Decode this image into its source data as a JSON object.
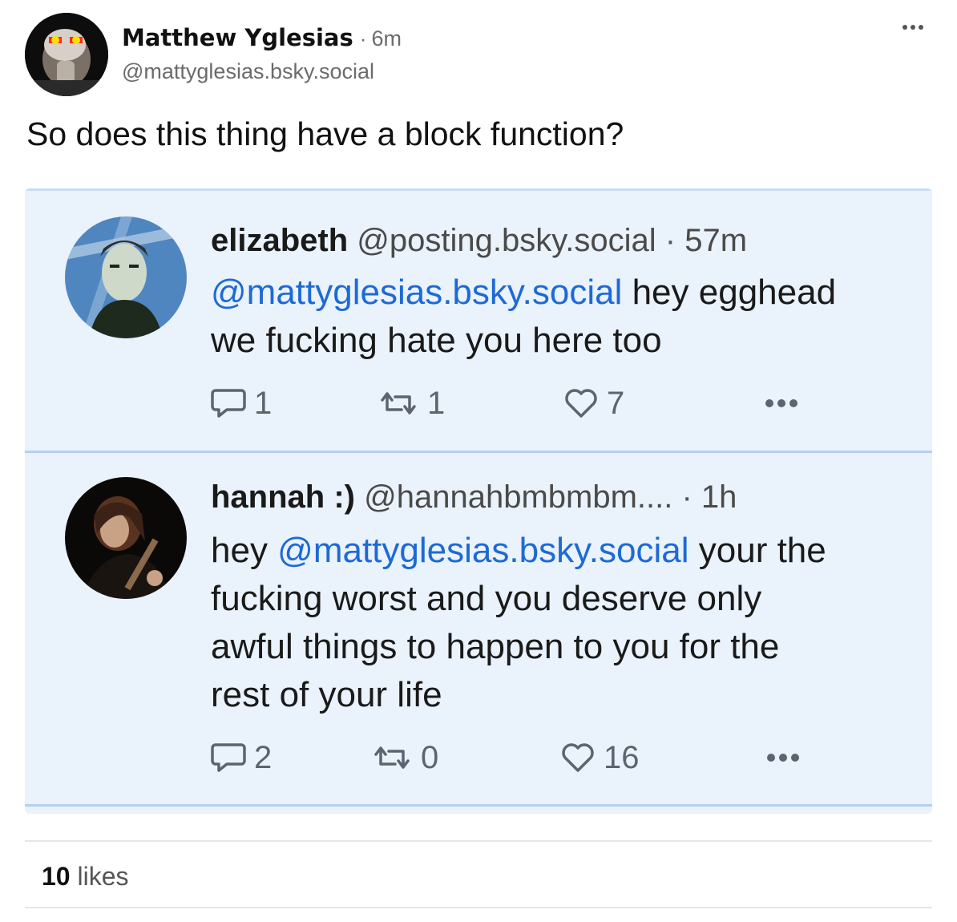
{
  "post": {
    "author_name": "Matthew Yglesias",
    "separator": "·",
    "time": "6m",
    "handle": "@mattyglesias.bsky.social",
    "text": "So does this thing have a block function?",
    "more_icon": "ellipsis-icon"
  },
  "embed": {
    "replies": [
      {
        "name": "elizabeth",
        "handle": "@posting.bsky.social",
        "separator": "·",
        "time": "57m",
        "mention": "@mattyglesias.bsky.social",
        "text_line1_rest": " hey egghead",
        "text_line2": "we fucking hate you here too",
        "reply_count": "1",
        "repost_count": "1",
        "like_count": "7"
      },
      {
        "name": "hannah :)",
        "handle": "@hannahbmbmbm....",
        "separator": "·",
        "time": "1h",
        "text_prefix": "hey ",
        "mention": "@mattyglesias.bsky.social",
        "text_line1_rest": " your the",
        "text_line2": "fucking worst and you deserve only",
        "text_line3": "awful things to happen to you for the",
        "text_line4": "rest of your life",
        "reply_count": "2",
        "repost_count": "0",
        "like_count": "16"
      }
    ]
  },
  "likes": {
    "count": "10",
    "label": "likes"
  },
  "colors": {
    "embed_bg": "#eaf2fc",
    "mention": "#1d6ad6",
    "muted": "#6b6b6b"
  }
}
